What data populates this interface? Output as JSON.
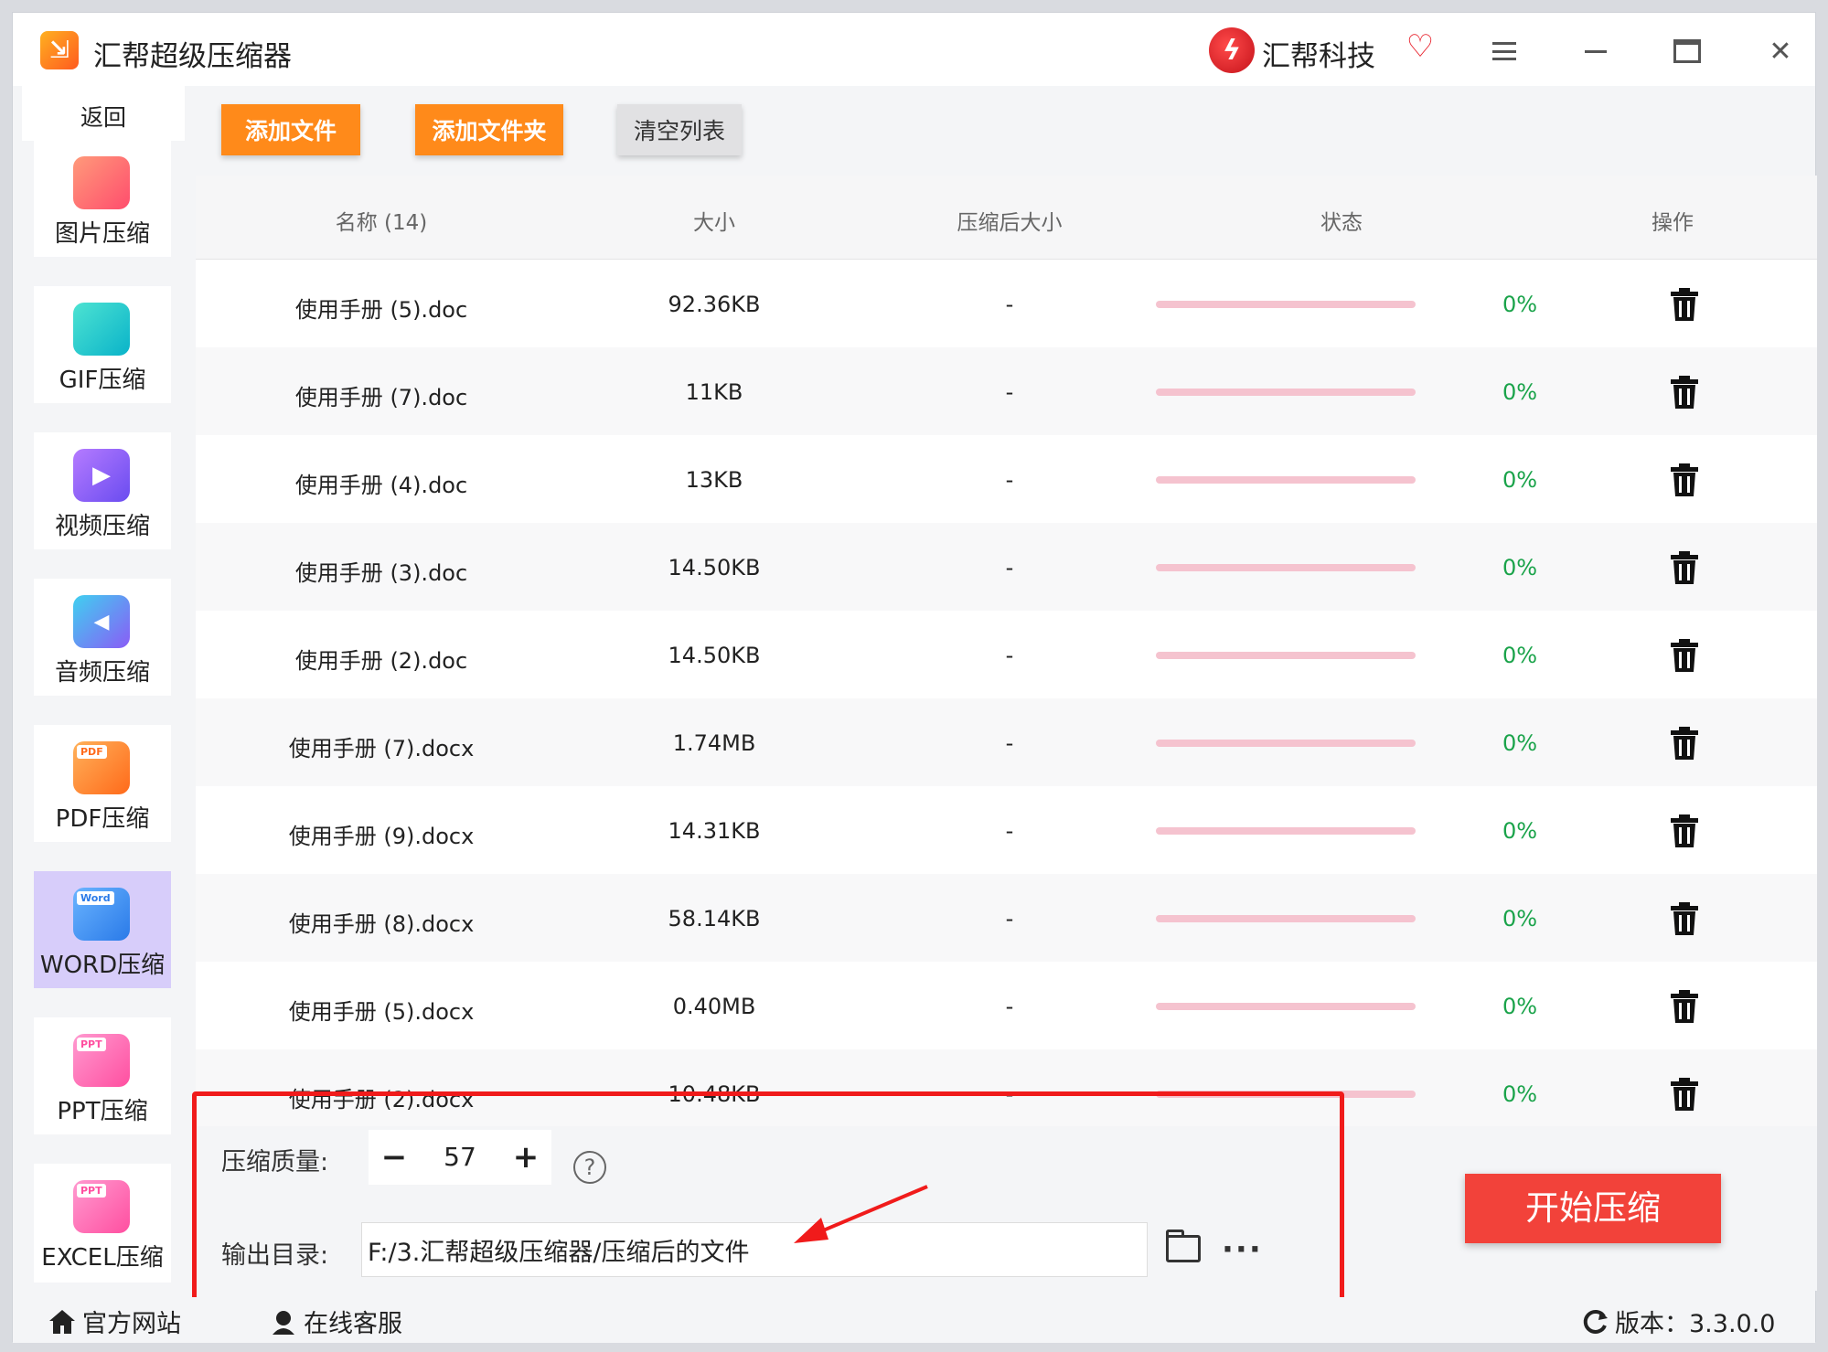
{
  "titlebar": {
    "app_title": "汇帮超级压缩器",
    "brand_name": "汇帮科技"
  },
  "sidebar": {
    "back_label": "返回",
    "items": [
      {
        "label": "图片压缩",
        "color": "#ff5f6d"
      },
      {
        "label": "GIF压缩",
        "color": "#11c5c6"
      },
      {
        "label": "视频压缩",
        "color": "#8a5cf6"
      },
      {
        "label": "音频压缩",
        "color": "#7a7cf6"
      },
      {
        "label": "PDF压缩",
        "tag": "PDF",
        "color": "#ff7a1a"
      },
      {
        "label": "WORD压缩",
        "tag": "Word",
        "color": "#3a8cf6"
      },
      {
        "label": "PPT压缩",
        "tag": "PPT",
        "color": "#ff5fa8"
      },
      {
        "label": "EXCEL压缩",
        "tag": "PPT",
        "color": "#ff5fa8"
      }
    ]
  },
  "toolbar": {
    "add_file": "添加文件",
    "add_folder": "添加文件夹",
    "clear_list": "清空列表"
  },
  "table": {
    "headers": [
      "名称 (14)",
      "大小",
      "压缩后大小",
      "状态",
      "操作"
    ],
    "rows": [
      {
        "name": "使用手册 (5).doc",
        "size": "92.36KB",
        "compressed": "-",
        "progress": "0%"
      },
      {
        "name": "使用手册 (7).doc",
        "size": "11KB",
        "compressed": "-",
        "progress": "0%"
      },
      {
        "name": "使用手册 (4).doc",
        "size": "13KB",
        "compressed": "-",
        "progress": "0%"
      },
      {
        "name": "使用手册 (3).doc",
        "size": "14.50KB",
        "compressed": "-",
        "progress": "0%"
      },
      {
        "name": "使用手册 (2).doc",
        "size": "14.50KB",
        "compressed": "-",
        "progress": "0%"
      },
      {
        "name": "使用手册 (7).docx",
        "size": "1.74MB",
        "compressed": "-",
        "progress": "0%"
      },
      {
        "name": "使用手册 (9).docx",
        "size": "14.31KB",
        "compressed": "-",
        "progress": "0%"
      },
      {
        "name": "使用手册 (8).docx",
        "size": "58.14KB",
        "compressed": "-",
        "progress": "0%"
      },
      {
        "name": "使用手册 (5).docx",
        "size": "0.40MB",
        "compressed": "-",
        "progress": "0%"
      },
      {
        "name": "使用手册 (2).docx",
        "size": "10.48KB",
        "compressed": "-",
        "progress": "0%"
      }
    ]
  },
  "settings": {
    "quality_label": "压缩质量:",
    "quality_value": "57",
    "output_label": "输出目录:",
    "output_path": "F:/3.汇帮超级压缩器/压缩后的文件",
    "start_button": "开始压缩"
  },
  "footer": {
    "website": "官方网站",
    "support": "在线客服",
    "version": "版本：3.3.0.0"
  },
  "colors": {
    "accent_orange": "#ff8a1a",
    "start_red": "#f2423a",
    "progress_green": "#1aa34a",
    "annotation_red": "#f01b1b"
  }
}
